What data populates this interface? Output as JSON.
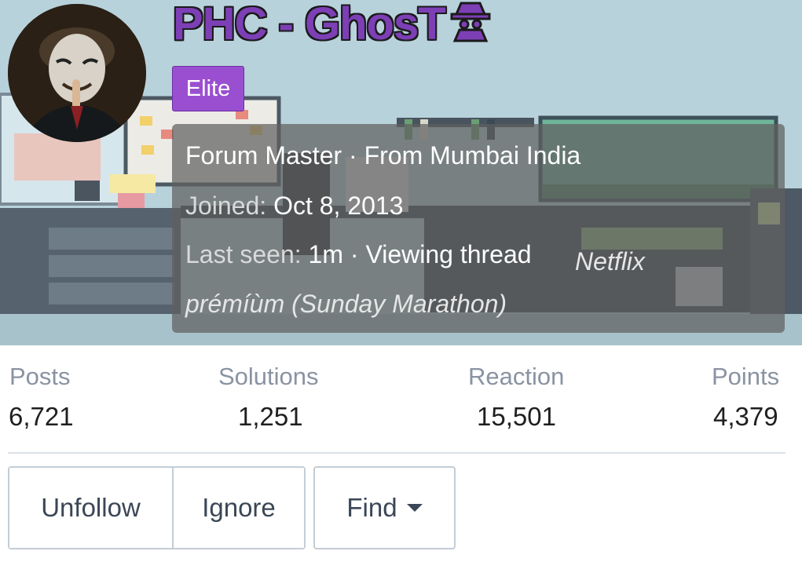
{
  "profile": {
    "username": "PHC - GhosT",
    "username_icon": "spy-icon",
    "badge": "Elite",
    "title_line": "Forum Master · From Mumbai India",
    "joined_label": "Joined:",
    "joined_date": "Oct 8, 2013",
    "last_seen_label": "Last seen:",
    "last_seen_value": "1m · Viewing thread",
    "thread_title": "Netflix prémíùm (Sunday Marathon)"
  },
  "stats": [
    {
      "label": "Posts",
      "value": "6,721"
    },
    {
      "label": "Solutions",
      "value": "1,251"
    },
    {
      "label": "Reaction",
      "value": "15,501"
    },
    {
      "label": "Points",
      "value": "4,379"
    }
  ],
  "actions": {
    "unfollow": "Unfollow",
    "ignore": "Ignore",
    "find": "Find"
  },
  "colors": {
    "username": "#7d3fb5",
    "badge": "#9a4fd0",
    "stat_label": "#8a93a2",
    "button_text": "#3b4656"
  }
}
